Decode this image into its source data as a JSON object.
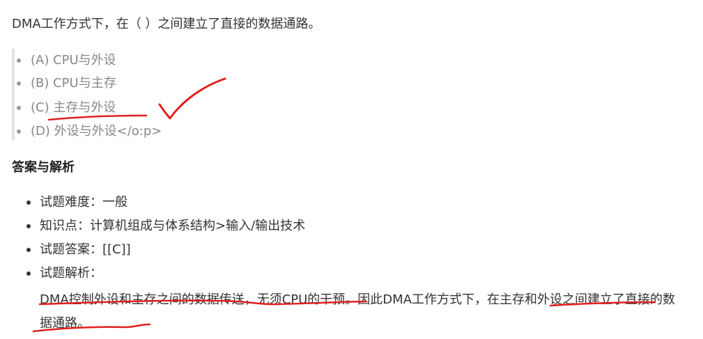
{
  "question": {
    "text": "DMA工作方式下，在（  ）之间建立了直接的数据通路。"
  },
  "options": [
    {
      "label": "(A) CPU与外设"
    },
    {
      "label": "(B) CPU与主存"
    },
    {
      "label": "(C) 主存与外设"
    },
    {
      "label": "(D) 外设与外设</o:p>"
    }
  ],
  "answer_section": {
    "title": "答案与解析",
    "items": [
      {
        "text": "试题难度：一般"
      },
      {
        "text": "知识点：计算机组成与体系结构>输入/输出技术"
      },
      {
        "text": "试题答案：[[C]]"
      },
      {
        "text": "试题解析："
      }
    ],
    "analysis": "DMA控制外设和主存之间的数据传送，无须CPU的干预。因此DMA工作方式下，在主存和外设之间建立了直接的数据通路。"
  },
  "annotation_color": "#e02020"
}
